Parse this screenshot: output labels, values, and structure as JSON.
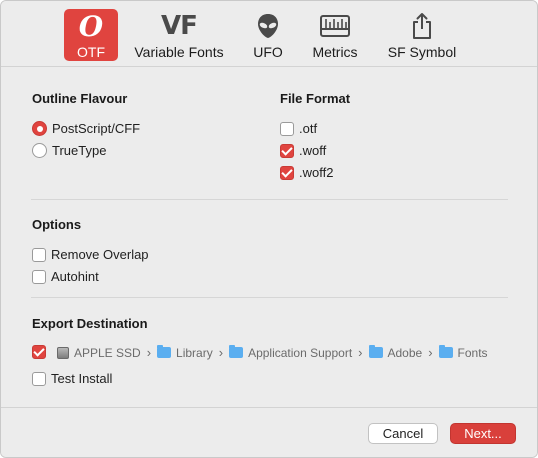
{
  "toolbar": {
    "tabs": [
      {
        "label": "OTF",
        "icon": "otf-icon",
        "glyph": "O",
        "active": true
      },
      {
        "label": "Variable Fonts",
        "icon": "vf-icon",
        "glyph": "VF"
      },
      {
        "label": "UFO",
        "icon": "alien-icon"
      },
      {
        "label": "Metrics",
        "icon": "ruler-icon"
      },
      {
        "label": "SF Symbol",
        "icon": "share-icon"
      }
    ]
  },
  "outline": {
    "title": "Outline Flavour",
    "options": [
      {
        "label": "PostScript/CFF",
        "selected": true
      },
      {
        "label": "TrueType",
        "selected": false
      }
    ]
  },
  "file_format": {
    "title": "File Format",
    "options": [
      {
        "label": ".otf",
        "checked": false
      },
      {
        "label": ".woff",
        "checked": true
      },
      {
        "label": ".woff2",
        "checked": true
      }
    ]
  },
  "options": {
    "title": "Options",
    "items": [
      {
        "label": "Remove Overlap",
        "checked": false
      },
      {
        "label": "Autohint",
        "checked": false
      }
    ]
  },
  "export": {
    "title": "Export Destination",
    "enabled": true,
    "path": [
      "APPLE SSD",
      "Library",
      "Application Support",
      "Adobe",
      "Fonts"
    ],
    "test_install_label": "Test Install",
    "test_install_checked": false
  },
  "footer": {
    "cancel_label": "Cancel",
    "next_label": "Next..."
  },
  "colors": {
    "accent": "#e0443f",
    "folder": "#5aaef0",
    "background": "#ececec"
  }
}
